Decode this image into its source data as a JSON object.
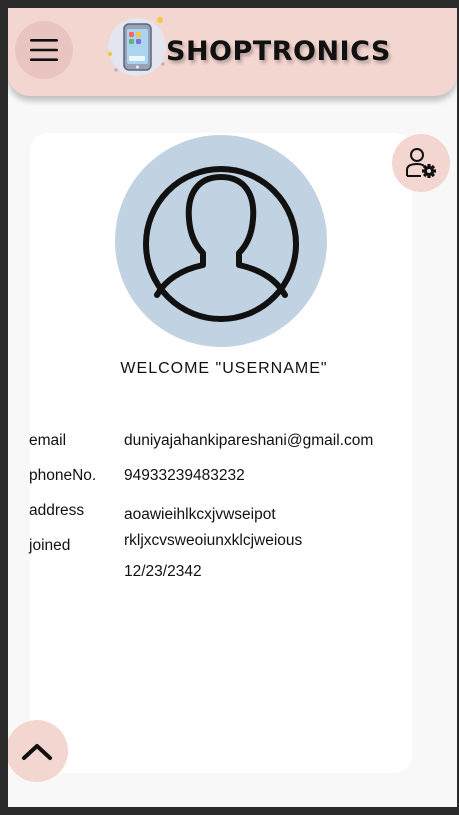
{
  "app": {
    "brand": "SHOPTRONICS"
  },
  "icons": {
    "menu": "menu-icon",
    "logo": "phone-logo-icon",
    "settings": "user-settings-icon",
    "avatar": "user-avatar-icon",
    "scroll_up": "chevron-up-icon"
  },
  "colors": {
    "header_bg": "#f4d6d0",
    "avatar_bg": "#c1d2e2",
    "card_bg": "#ffffff"
  },
  "profile": {
    "welcome": "WELCOME \"USERNAME\"",
    "fields": [
      {
        "label": "email",
        "value": "duniyajahankipareshani@gmail.com"
      },
      {
        "label": "phoneNo.",
        "value": "94933239483232"
      },
      {
        "label": "address",
        "value": "aoawieihlkcxjvwseipot\nrkljxcvsweoiunxklcjweious"
      },
      {
        "label": "joined",
        "value": "12/23/2342"
      }
    ]
  }
}
